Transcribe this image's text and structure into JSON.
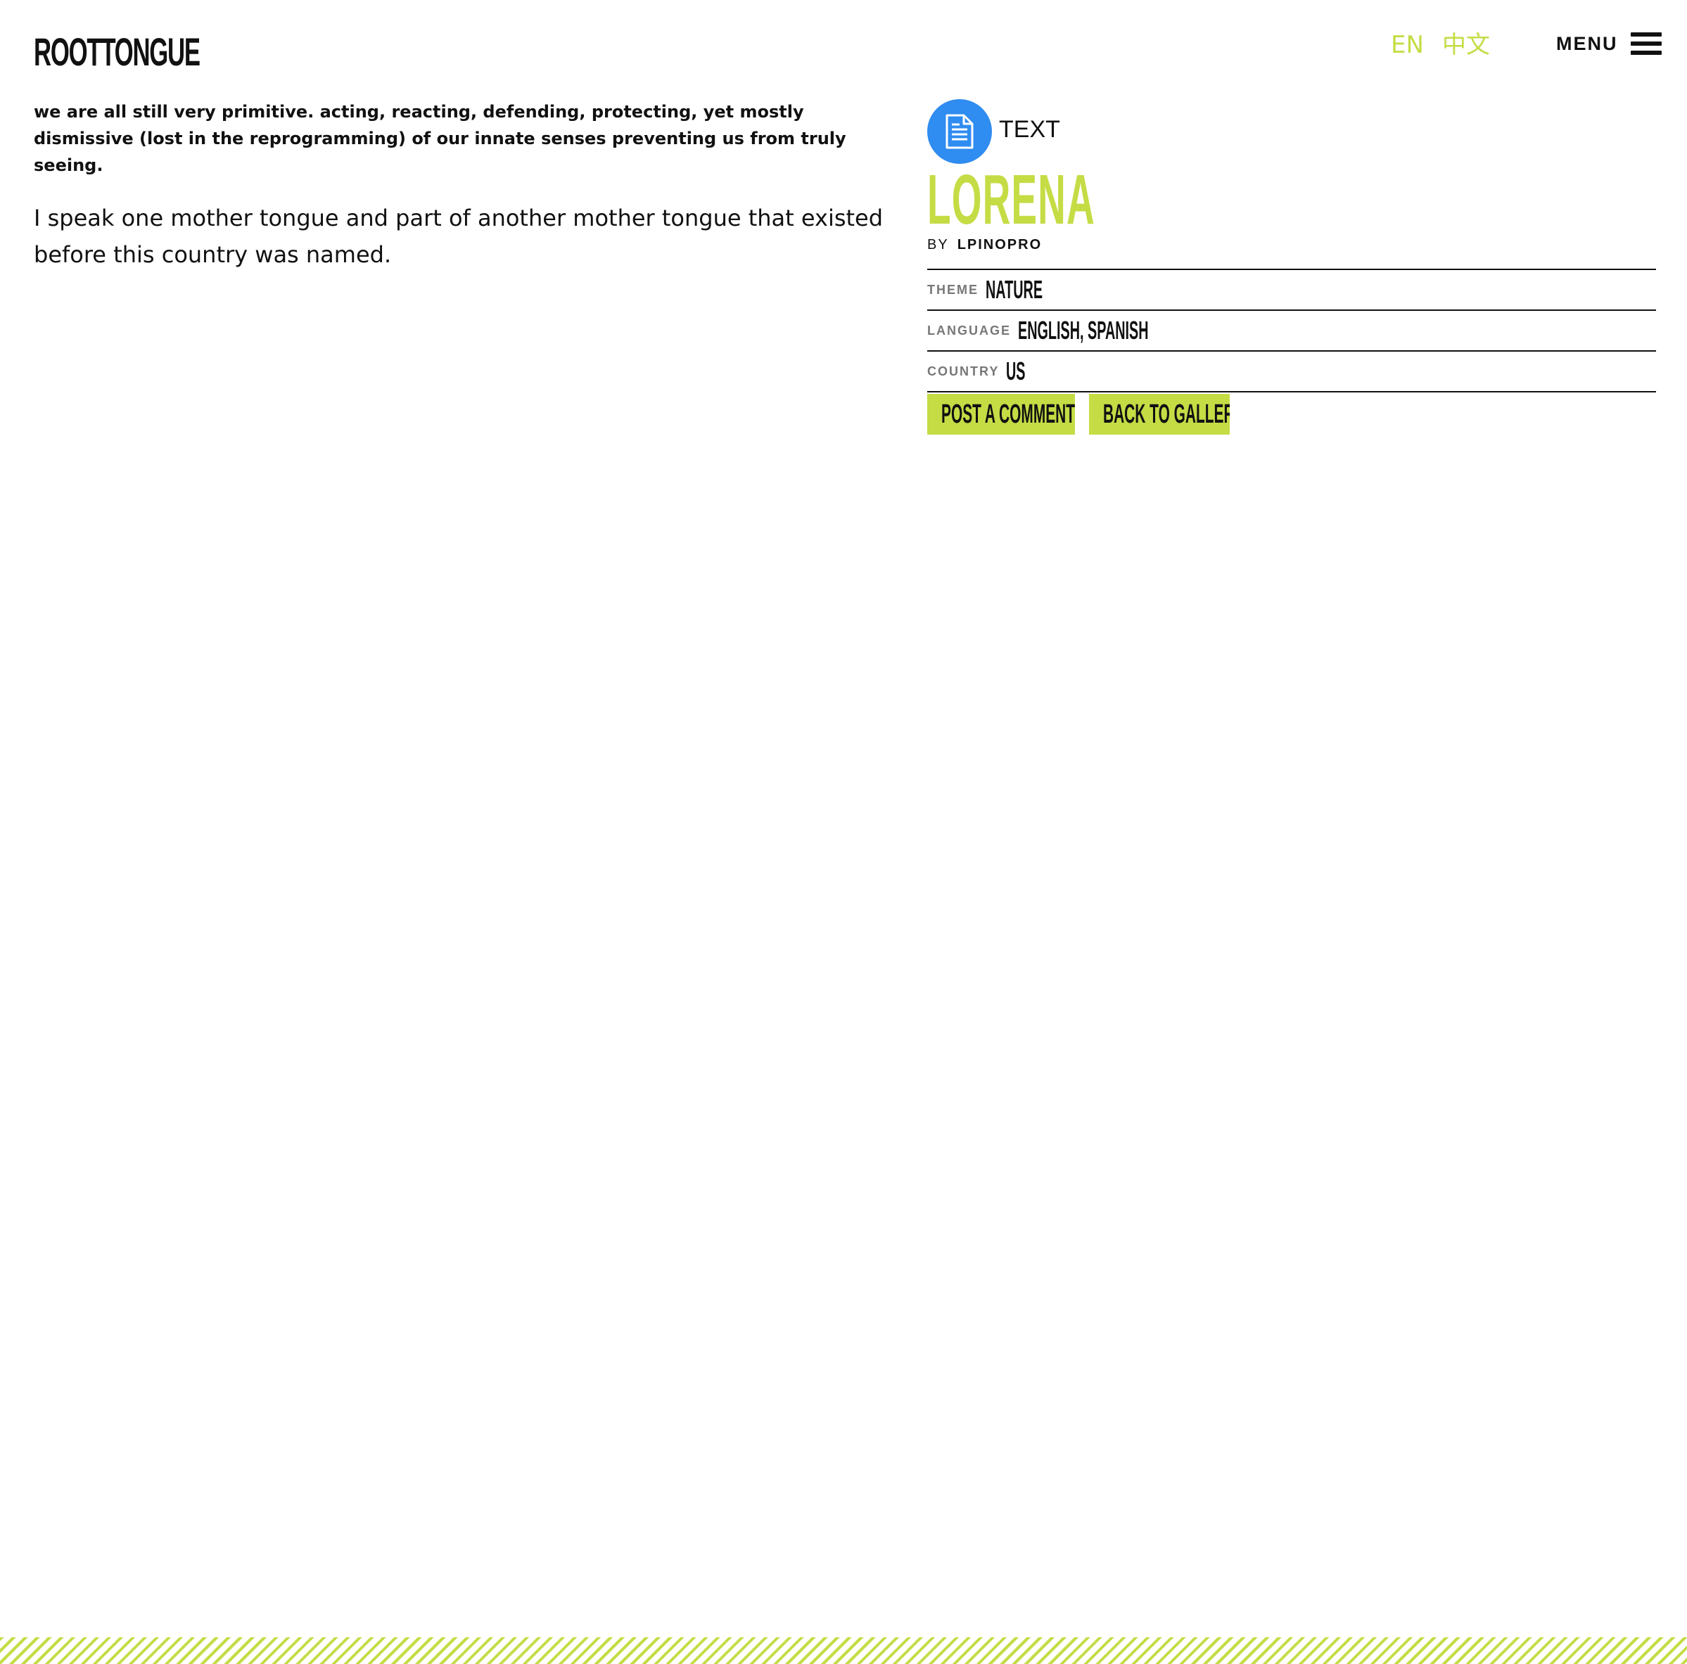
{
  "header": {
    "logo": "ROOTTONGUE",
    "lang_en": "EN",
    "lang_zh": "中文",
    "menu_label": "MENU"
  },
  "content": {
    "lead": "we are all still very primitive. acting, reacting, defending, protecting, yet mostly dismissive (lost in the reprogramming) of our innate senses preventing us from truly seeing.",
    "body": "I speak one mother tongue and part of another mother tongue that existed before this country was named."
  },
  "entry": {
    "type_icon": "document-icon",
    "type_label": "TEXT",
    "title": "LORENA",
    "by_label": "BY",
    "author": "LPINOPRO",
    "meta": [
      {
        "label": "THEME",
        "value": "NATURE"
      },
      {
        "label": "LANGUAGE",
        "value": "ENGLISH, SPANISH"
      },
      {
        "label": "COUNTRY",
        "value": "US"
      }
    ],
    "buttons": {
      "post": "POST A COMMENT",
      "back": "BACK TO GALLERY"
    }
  },
  "colors": {
    "accent": "#c5dc45",
    "icon_bg": "#2f8cf0",
    "text": "#111111"
  }
}
